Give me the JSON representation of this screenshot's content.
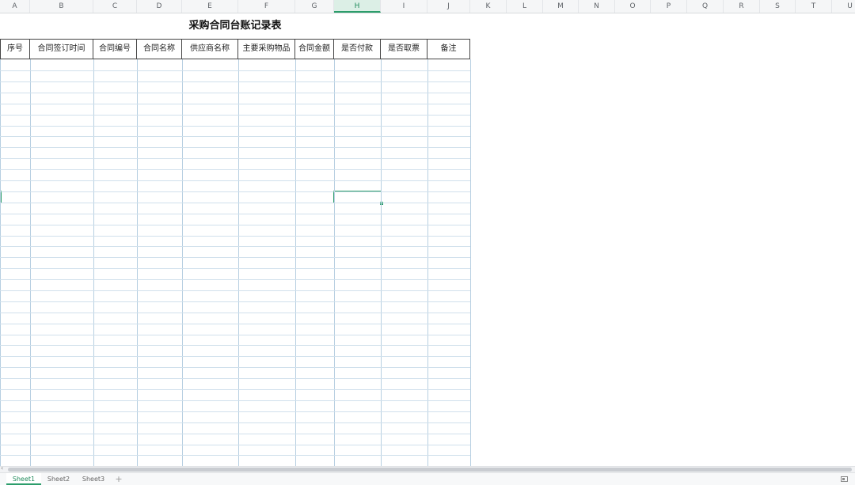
{
  "columns": [
    "A",
    "B",
    "C",
    "D",
    "E",
    "F",
    "G",
    "H",
    "I",
    "J",
    "K",
    "L",
    "M",
    "N",
    "O",
    "P",
    "Q",
    "R",
    "S",
    "T",
    "U"
  ],
  "selected_column": "H",
  "table": {
    "title": "采购合同台账记录表",
    "headers": [
      "序号",
      "合同签订时间",
      "合同编号",
      "合同名称",
      "供应商名称",
      "主要采购物品",
      "合同金额",
      "是否付款",
      "是否取票",
      "备注"
    ]
  },
  "sheets": [
    {
      "label": "Sheet1",
      "active": true
    },
    {
      "label": "Sheet2",
      "active": false
    },
    {
      "label": "Sheet3",
      "active": false
    }
  ],
  "add_sheet_label": "+",
  "colors": {
    "accent": "#2c9d6b",
    "grid": "#b7cfe1",
    "header_border": "#444444"
  }
}
